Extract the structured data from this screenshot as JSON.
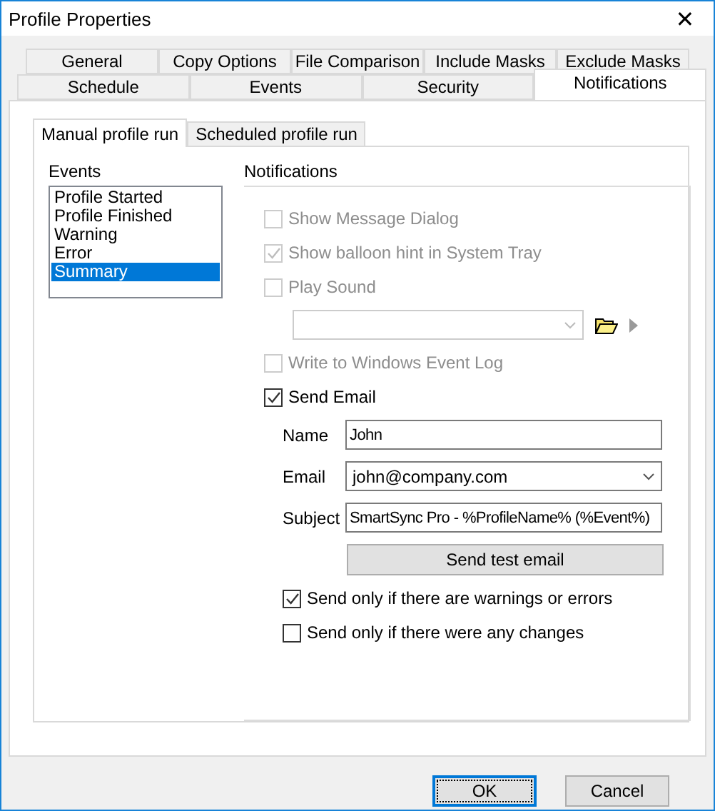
{
  "window": {
    "title": "Profile Properties",
    "close": "✕"
  },
  "tab_rows": [
    [
      {
        "label": "General",
        "selected": false
      },
      {
        "label": "Copy Options",
        "selected": false
      },
      {
        "label": "File Comparison",
        "selected": false
      },
      {
        "label": "Include Masks",
        "selected": false
      },
      {
        "label": "Exclude Masks",
        "selected": false
      }
    ],
    [
      {
        "label": "Schedule",
        "selected": false
      },
      {
        "label": "Events",
        "selected": false
      },
      {
        "label": "Security",
        "selected": false
      },
      {
        "label": "Notifications",
        "selected": true
      }
    ]
  ],
  "sub_tabs": [
    {
      "label": "Manual profile run",
      "selected": true
    },
    {
      "label": "Scheduled profile run",
      "selected": false
    }
  ],
  "events": {
    "title": "Events",
    "items": [
      {
        "label": "Profile Started",
        "selected": false
      },
      {
        "label": "Profile Finished",
        "selected": false
      },
      {
        "label": "Warning",
        "selected": false
      },
      {
        "label": "Error",
        "selected": false
      },
      {
        "label": "Summary",
        "selected": true
      }
    ]
  },
  "notifications": {
    "title": "Notifications",
    "options": [
      {
        "kind": "checkbox",
        "label": "Show Message Dialog",
        "checked": false,
        "disabled": true
      },
      {
        "kind": "checkbox",
        "label": "Show balloon hint in System Tray",
        "checked": true,
        "disabled": true
      },
      {
        "kind": "checkbox",
        "label": "Play Sound",
        "checked": false,
        "disabled": true
      },
      {
        "kind": "sound",
        "disabled": true
      },
      {
        "kind": "checkbox",
        "label": "Write to Windows Event Log",
        "checked": false,
        "disabled": true
      },
      {
        "kind": "checkbox",
        "label": "Send Email",
        "checked": true,
        "disabled": false
      }
    ],
    "email_fields": [
      {
        "kind": "text",
        "label": "Name",
        "value": "John"
      },
      {
        "kind": "combo",
        "label": "Email",
        "value": "john@company.com"
      },
      {
        "kind": "text",
        "label": "Subject",
        "value": "SmartSync Pro - %ProfileName% (%Event%)"
      }
    ],
    "test_button": "Send test email",
    "conditions": [
      {
        "label": "Send only if there are warnings or errors",
        "checked": true
      },
      {
        "label": "Send only if there were any changes",
        "checked": false
      }
    ]
  },
  "buttons": [
    {
      "label": "OK",
      "default": true
    },
    {
      "label": "Cancel",
      "default": false
    }
  ]
}
